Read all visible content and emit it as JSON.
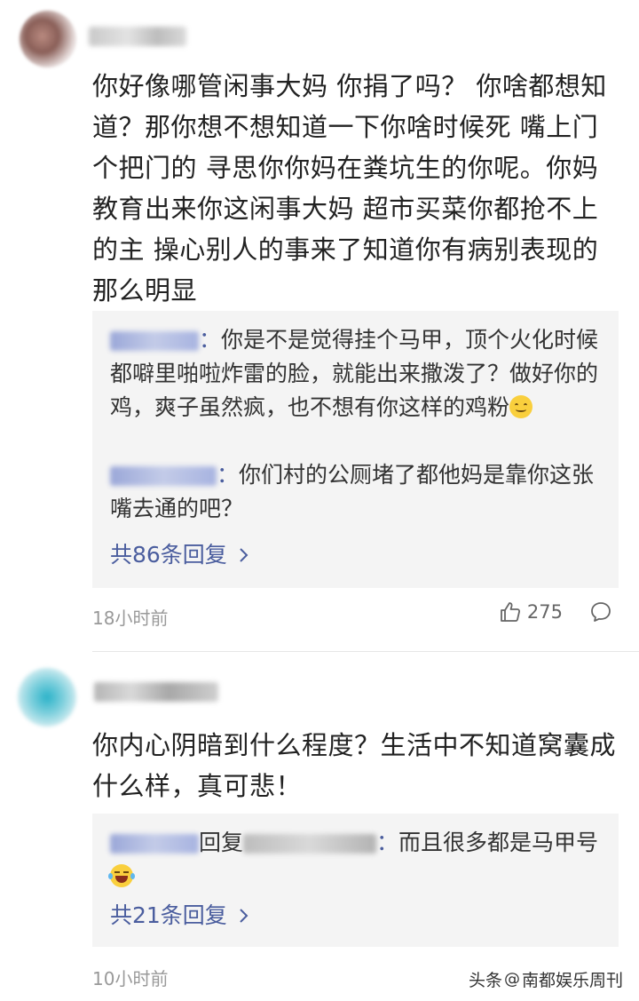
{
  "comments": [
    {
      "text": "你好像哪管闲事大妈 你捐了吗？ 你啥都想知道？那你想不想知道一下你啥时候死 嘴上门个把门的 寻思你你妈在粪坑生的你呢。你妈教育出来你这闲事大妈 超市买菜你都抢不上的主 操心别人的事来了知道你有病别表现的那么明显",
      "replies": [
        {
          "author_suffix": "：",
          "text": "你是不是觉得挂个马甲，顶个火化时候都噼里啪啦炸雷的脸，就能出来撒泼了？做好你的鸡，爽子虽然疯，也不想有你这样的鸡粉"
        },
        {
          "author_suffix": "：",
          "text": "你们村的公厕堵了都他妈是靠你这张嘴去通的吧？"
        }
      ],
      "more_replies": "共86条回复",
      "time": "18小时前",
      "likes": "275"
    },
    {
      "text": "你内心阴暗到什么程度？生活中不知道窝囊成什么样，真可悲！",
      "replies": [
        {
          "reply_word": "回复",
          "author_suffix": "：",
          "text": "而且很多都是马甲号"
        }
      ],
      "more_replies": "共21条回复",
      "time": "10小时前"
    }
  ],
  "watermark": {
    "prefix": "头条",
    "at": "@",
    "account": "南都娱乐周刊"
  },
  "icons": {
    "like": "thumbs-up-icon",
    "comment": "comment-bubble-icon",
    "chevron": "chevron-right-icon",
    "emoji_smile": "smile-emoji-icon",
    "emoji_laugh": "laugh-tears-emoji-icon"
  },
  "colors": {
    "link": "#4a5d9e",
    "reply_bg": "#f4f4f4",
    "meta": "#999999"
  }
}
